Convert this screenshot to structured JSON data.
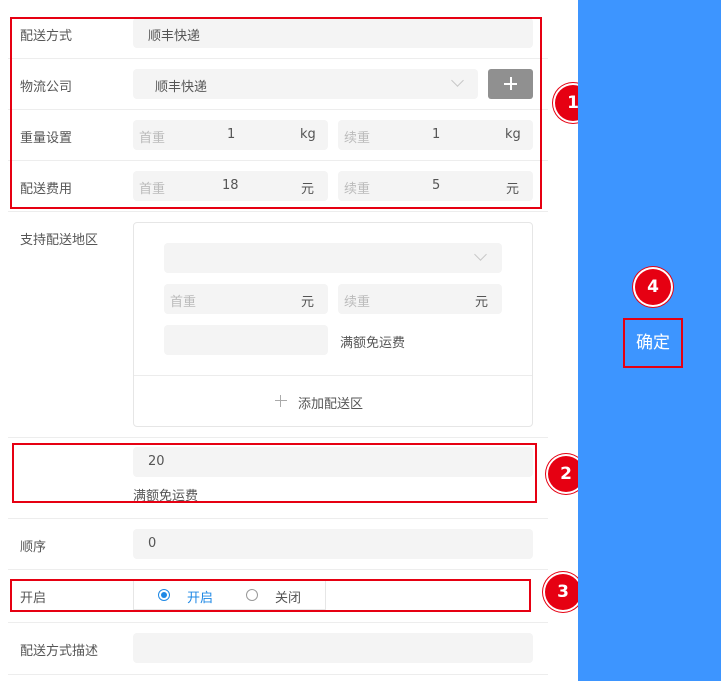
{
  "form": {
    "delivery_method": {
      "label": "配送方式",
      "value": "顺丰快递"
    },
    "logistics_company": {
      "label": "物流公司",
      "value": "顺丰快递"
    },
    "weight_setting": {
      "label": "重量设置",
      "first": {
        "placeholder": "首重",
        "value": "1",
        "unit": "kg"
      },
      "additional": {
        "placeholder": "续重",
        "value": "1",
        "unit": "kg"
      }
    },
    "delivery_fee": {
      "label": "配送费用",
      "first": {
        "placeholder": "首重",
        "value": "18",
        "unit": "元"
      },
      "additional": {
        "placeholder": "续重",
        "value": "5",
        "unit": "元"
      }
    },
    "supported_regions": {
      "label": "支持配送地区",
      "first": {
        "placeholder": "首重",
        "unit": "元"
      },
      "additional": {
        "placeholder": "续重",
        "unit": "元"
      },
      "free_shipping_label": "满额免运费",
      "add_region_label": "添加配送区"
    },
    "free_shipping": {
      "value": "20",
      "label": "满额免运费"
    },
    "order": {
      "label": "顺序",
      "value": "0"
    },
    "enabled": {
      "label": "开启",
      "option_on": "开启",
      "option_off": "关闭",
      "selected": "开启"
    },
    "description": {
      "label": "配送方式描述",
      "value": ""
    }
  },
  "sidebar": {
    "confirm_label": "确定"
  },
  "annotations": [
    "1",
    "2",
    "3",
    "4"
  ],
  "colors": {
    "accent_blue": "#3d95ff",
    "annotation_red": "#e60012",
    "radio_blue": "#1e88e5"
  }
}
